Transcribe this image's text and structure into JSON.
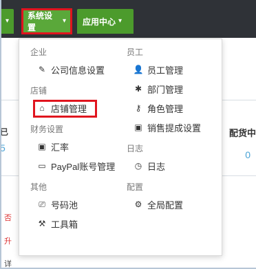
{
  "topbar": {
    "tabs": [
      {
        "label": ""
      },
      {
        "label": "系统设置"
      },
      {
        "label": "应用中心"
      }
    ],
    "caret": "▾"
  },
  "background": {
    "left_text_1": "已",
    "left_num": "5",
    "left_red_1": "否",
    "left_red_2": "升",
    "left_text_2": "详",
    "right_text": "配货中",
    "right_num": "0"
  },
  "menu": {
    "left": [
      {
        "group": "企业",
        "items": [
          {
            "icon": "edit-icon",
            "glyph": "✎",
            "label": "公司信息设置"
          }
        ]
      },
      {
        "group": "店铺",
        "items": [
          {
            "icon": "home-icon",
            "glyph": "⌂",
            "label": "店铺管理"
          }
        ]
      },
      {
        "group": "财务设置",
        "items": [
          {
            "icon": "money-icon",
            "glyph": "▣",
            "label": "汇率"
          },
          {
            "icon": "card-icon",
            "glyph": "▭",
            "label": "PayPal账号管理"
          }
        ]
      },
      {
        "group": "其他",
        "items": [
          {
            "icon": "inbox-icon",
            "glyph": "⎚",
            "label": "号码池"
          },
          {
            "icon": "hammer-icon",
            "glyph": "⚒",
            "label": "工具箱"
          }
        ]
      }
    ],
    "right": [
      {
        "group": "员工",
        "items": [
          {
            "icon": "user-icon",
            "glyph": "👤",
            "label": "员工管理"
          },
          {
            "icon": "asterisk-icon",
            "glyph": "✱",
            "label": "部门管理"
          },
          {
            "icon": "key-icon",
            "glyph": "⚷",
            "label": "角色管理"
          },
          {
            "icon": "money-icon",
            "glyph": "▣",
            "label": "销售提成设置"
          }
        ]
      },
      {
        "group": "日志",
        "items": [
          {
            "icon": "clock-icon",
            "glyph": "◷",
            "label": "日志"
          }
        ]
      },
      {
        "group": "配置",
        "items": [
          {
            "icon": "gear-icon",
            "glyph": "⚙",
            "label": "全局配置"
          }
        ]
      }
    ]
  },
  "colors": {
    "topbar": "#2f3237",
    "tab_green": "#4c9b2c",
    "highlight_red": "#e0141e"
  }
}
